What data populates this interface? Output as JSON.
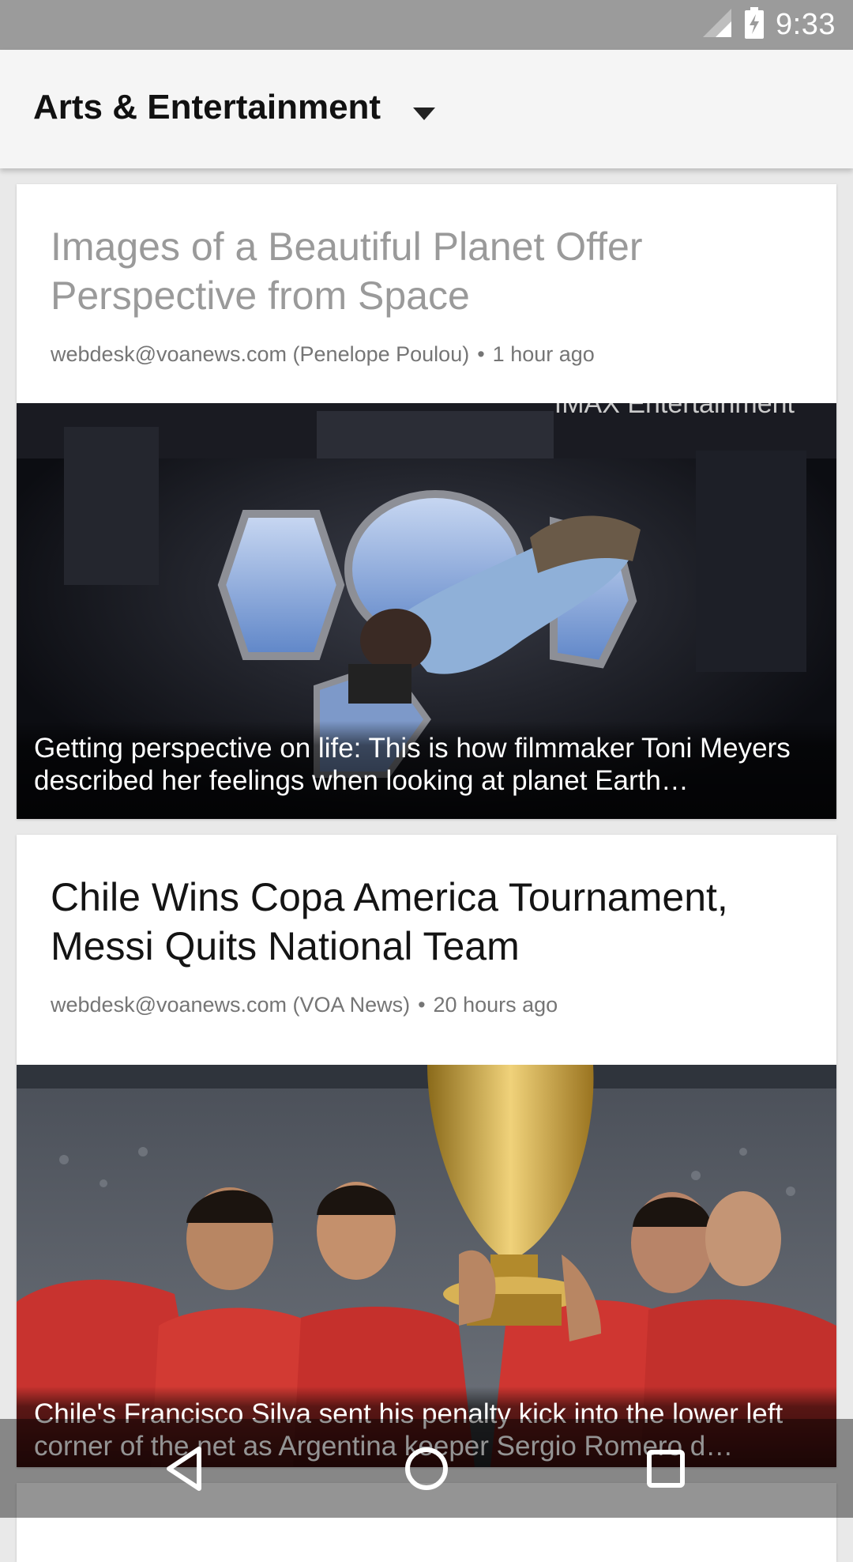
{
  "status_bar": {
    "time": "9:33",
    "icons": [
      "signal-icon",
      "battery-charging-icon"
    ]
  },
  "app_bar": {
    "title": "Arts & Entertainment",
    "dropdown_icon": "dropdown-arrow-icon"
  },
  "feed": {
    "articles": [
      {
        "title": "Images of a Beautiful Planet Offer Perspective from Space",
        "source": "webdesk@voanews.com (Penelope Poulou)",
        "time_ago": "1 hour ago",
        "image_watermark": "IMAX Entertainment",
        "caption": "Getting perspective on life: This is how filmmaker Toni Meyers described her feelings when looking at planet Earth…"
      },
      {
        "title": "Chile Wins Copa America Tournament, Messi Quits National Team",
        "source": "webdesk@voanews.com (VOA News)",
        "time_ago": "20 hours ago",
        "caption": "Chile's Francisco Silva sent his penalty kick into the lower left corner of the net as Argentina keeper Sergio Romero d…"
      }
    ]
  },
  "nav_bar": {
    "icons": [
      "back-icon",
      "home-icon",
      "recents-icon"
    ]
  },
  "colors": {
    "status_bar": "#9b9b9b",
    "app_bar": "#f5f5f5",
    "background": "#e9e9e9"
  }
}
